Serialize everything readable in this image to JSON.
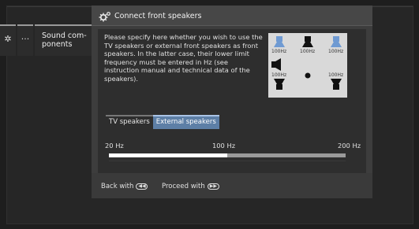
{
  "breadcrumb": {
    "gear_icon": "gear-icon",
    "dots_label": "···",
    "sound_label": "Sound com-\nponents"
  },
  "dialog": {
    "title": "Connect front speakers",
    "description": "Please specify here whether you wish to use the TV speakers or external front speakers as front speakers.  In the latter case, their lower limit frequency must be entered in Hz (see instruction manual and technical data of the speakers).",
    "diagram_labels": {
      "front_left": "100Hz",
      "center": "100Hz",
      "front_right": "100Hz",
      "rear_left": "100Hz",
      "rear_right": "100Hz"
    },
    "options": [
      {
        "label": "TV speakers",
        "selected": false
      },
      {
        "label": "External speakers",
        "selected": true
      }
    ],
    "frequency": {
      "min_label": "20 Hz",
      "mid_label": "100 Hz",
      "max_label": "200 Hz",
      "value_fraction": 0.5
    },
    "footer": {
      "back_label": "Back with",
      "back_button_icon": "rewind-button-icon",
      "proceed_label": "Proceed with",
      "proceed_button_icon": "fast-forward-button-icon"
    }
  },
  "colors": {
    "accent_blue": "#5d7fa6",
    "speaker_blue": "#6f9ad2",
    "background": "#1e1e1e"
  }
}
